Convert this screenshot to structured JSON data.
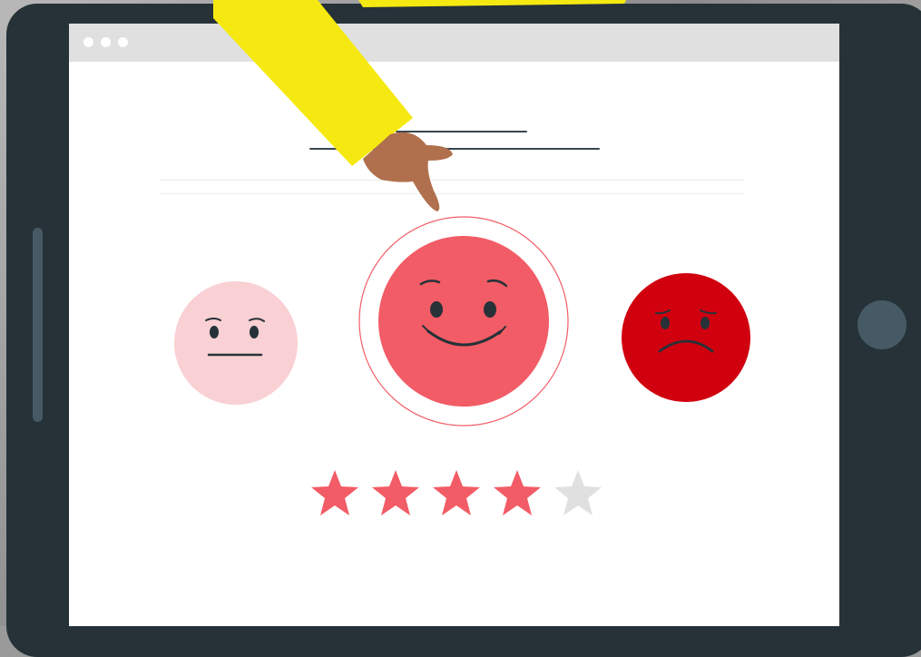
{
  "rating": {
    "value": 4,
    "max": 5
  },
  "faces": [
    {
      "mood": "neutral",
      "selected": false,
      "color": "#f9d0d3"
    },
    {
      "mood": "happy",
      "selected": true,
      "color": "#f25c66"
    },
    {
      "mood": "sad",
      "selected": false,
      "color": "#d0000f"
    }
  ],
  "colors": {
    "star_filled": "#f25c66",
    "star_empty": "#e0e0e0",
    "device_frame": "#263238",
    "screen_bar": "#e0e0e0",
    "sleeve": "#f5e911",
    "skin": "#b0704d"
  },
  "icons": [
    "window-dot-icon",
    "neutral-face-icon",
    "happy-face-icon",
    "sad-face-icon",
    "star-icon",
    "pointing-hand-icon"
  ]
}
